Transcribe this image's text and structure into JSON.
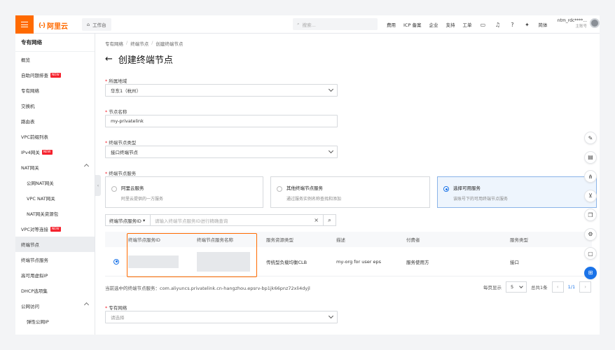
{
  "topbar": {
    "logo_text": "阿里云",
    "logo_mark": "(-)",
    "workbench_label": "工作台",
    "search_placeholder": "搜索...",
    "nav": [
      "费用",
      "ICP 备案",
      "企业",
      "支持",
      "工单"
    ],
    "lang_label": "简体",
    "user_name": "ntm_rdc****...",
    "user_role": "主账号"
  },
  "sidebar": {
    "title": "专有网络",
    "items": [
      {
        "label": "概览"
      },
      {
        "label": "自助问题排查",
        "badge": "NEW"
      },
      {
        "label": "专有网络"
      },
      {
        "label": "交换机"
      },
      {
        "label": "路由表"
      },
      {
        "label": "VPC前缀列表"
      },
      {
        "label": "IPv4网关",
        "badge": "NEW"
      },
      {
        "label": "NAT网关"
      },
      {
        "label": "公网NAT网关"
      },
      {
        "label": "VPC NAT网关"
      },
      {
        "label": "NAT网关资源包"
      },
      {
        "label": "VPC对等连接",
        "badge": "NEW"
      },
      {
        "label": "终端节点"
      },
      {
        "label": "终端节点服务"
      },
      {
        "label": "高可用虚拟IP"
      },
      {
        "label": "DHCP选项集"
      },
      {
        "label": "公网访问"
      },
      {
        "label": "弹性公网IP"
      }
    ]
  },
  "breadcrumb": [
    "专有网络",
    "终端节点",
    "创建终端节点"
  ],
  "page_title": "创建终端节点",
  "form": {
    "region_label": "所属地域",
    "region_value": "华东1（杭州）",
    "name_label": "节点名称",
    "name_value": "my-privatelink",
    "type_label": "终端节点类型",
    "type_value": "接口终端节点",
    "service_label": "终端节点服务",
    "vpc_label": "专有网络",
    "vpc_placeholder": "请选择"
  },
  "service_cards": [
    {
      "title": "阿里云服务",
      "desc": "阿里云提供的一方服务",
      "selected": false
    },
    {
      "title": "其他终端节点服务",
      "desc": "通过服务实例名称查找和添加",
      "selected": false
    },
    {
      "title": "选择可用服务",
      "desc": "该账号下的可用终端节点服务",
      "selected": true
    }
  ],
  "filter": {
    "select_label": "终端节点服务ID",
    "input_placeholder": "请输入终端节点服务ID进行精确查询"
  },
  "table": {
    "headers": [
      "终端节点服务ID",
      "终端节点服务名称",
      "服务资源类型",
      "描述",
      "付费者",
      "服务类型"
    ],
    "rows": [
      {
        "resource_type": "传统型负载均衡CLB",
        "desc": "my-org for user eps",
        "payer": "服务使用方",
        "service_type": "接口"
      }
    ]
  },
  "current_service_text": "当前选中的终端节点服务：com.aliyuncs.privatelink.cn-hangzhou.epsrv-bp1jk66pnz72xli4dyjl",
  "pager": {
    "page_size_label": "每页显示",
    "page_size": "5",
    "total": "总共1条",
    "current": "1/1"
  }
}
